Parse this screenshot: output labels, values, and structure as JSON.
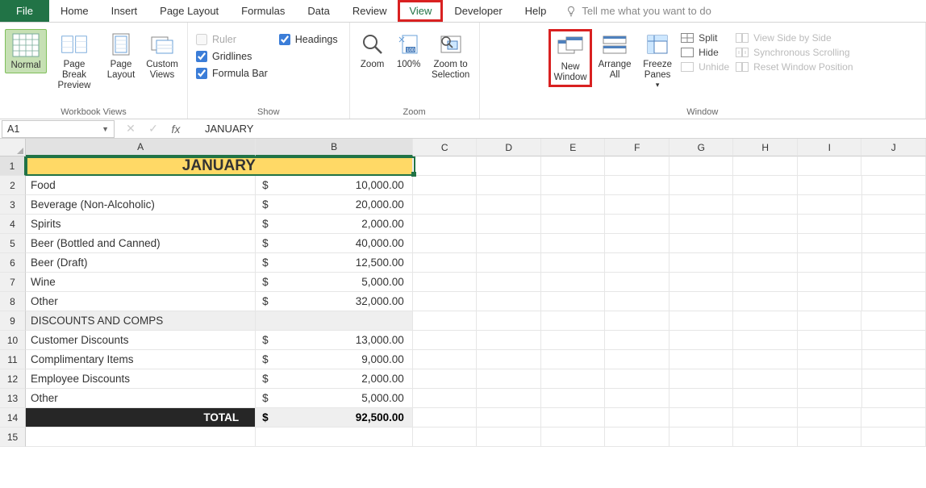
{
  "tabs": {
    "file": "File",
    "home": "Home",
    "insert": "Insert",
    "pageLayout": "Page Layout",
    "formulas": "Formulas",
    "data": "Data",
    "review": "Review",
    "view": "View",
    "developer": "Developer",
    "help": "Help",
    "tell": "Tell me what you want to do"
  },
  "ribbon": {
    "workbookViews": {
      "label": "Workbook Views",
      "normal": "Normal",
      "pageBreak1": "Page Break",
      "pageBreak2": "Preview",
      "pageLayout1": "Page",
      "pageLayout2": "Layout",
      "custom1": "Custom",
      "custom2": "Views"
    },
    "show": {
      "label": "Show",
      "ruler": "Ruler",
      "gridlines": "Gridlines",
      "formulaBar": "Formula Bar",
      "headings": "Headings"
    },
    "zoom": {
      "label": "Zoom",
      "zoom": "Zoom",
      "hundred": "100%",
      "zoomToSel1": "Zoom to",
      "zoomToSel2": "Selection"
    },
    "window": {
      "label": "Window",
      "newWin1": "New",
      "newWin2": "Window",
      "arrange1": "Arrange",
      "arrange2": "All",
      "freeze1": "Freeze",
      "freeze2": "Panes",
      "split": "Split",
      "hide": "Hide",
      "unhide": "Unhide",
      "sideBySide": "View Side by Side",
      "syncScroll": "Synchronous Scrolling",
      "resetPos": "Reset Window Position"
    }
  },
  "nameBox": "A1",
  "formulaBar": "JANUARY",
  "columns": [
    "A",
    "B",
    "C",
    "D",
    "E",
    "F",
    "G",
    "H",
    "I",
    "J"
  ],
  "colWidths": {
    "A": 287,
    "B": 196,
    "other": 80
  },
  "rows": [
    "1",
    "2",
    "3",
    "4",
    "5",
    "6",
    "7",
    "8",
    "9",
    "10",
    "11",
    "12",
    "13",
    "14",
    "15"
  ],
  "sheet": {
    "title": "JANUARY",
    "data": [
      {
        "label": "Food",
        "sym": "$",
        "val": "10,000.00"
      },
      {
        "label": "Beverage (Non-Alcoholic)",
        "sym": "$",
        "val": "20,000.00"
      },
      {
        "label": "Spirits",
        "sym": "$",
        "val": "2,000.00"
      },
      {
        "label": "Beer (Bottled and Canned)",
        "sym": "$",
        "val": "40,000.00"
      },
      {
        "label": "Beer (Draft)",
        "sym": "$",
        "val": "12,500.00"
      },
      {
        "label": "Wine",
        "sym": "$",
        "val": "5,000.00"
      },
      {
        "label": "Other",
        "sym": "$",
        "val": "32,000.00"
      }
    ],
    "section": "DISCOUNTS AND COMPS",
    "discounts": [
      {
        "label": "Customer Discounts",
        "sym": "$",
        "val": "13,000.00"
      },
      {
        "label": "Complimentary Items",
        "sym": "$",
        "val": "9,000.00"
      },
      {
        "label": "Employee Discounts",
        "sym": "$",
        "val": "2,000.00"
      },
      {
        "label": "Other",
        "sym": "$",
        "val": "5,000.00"
      }
    ],
    "total": {
      "label": "TOTAL",
      "sym": "$",
      "val": "92,500.00"
    }
  }
}
